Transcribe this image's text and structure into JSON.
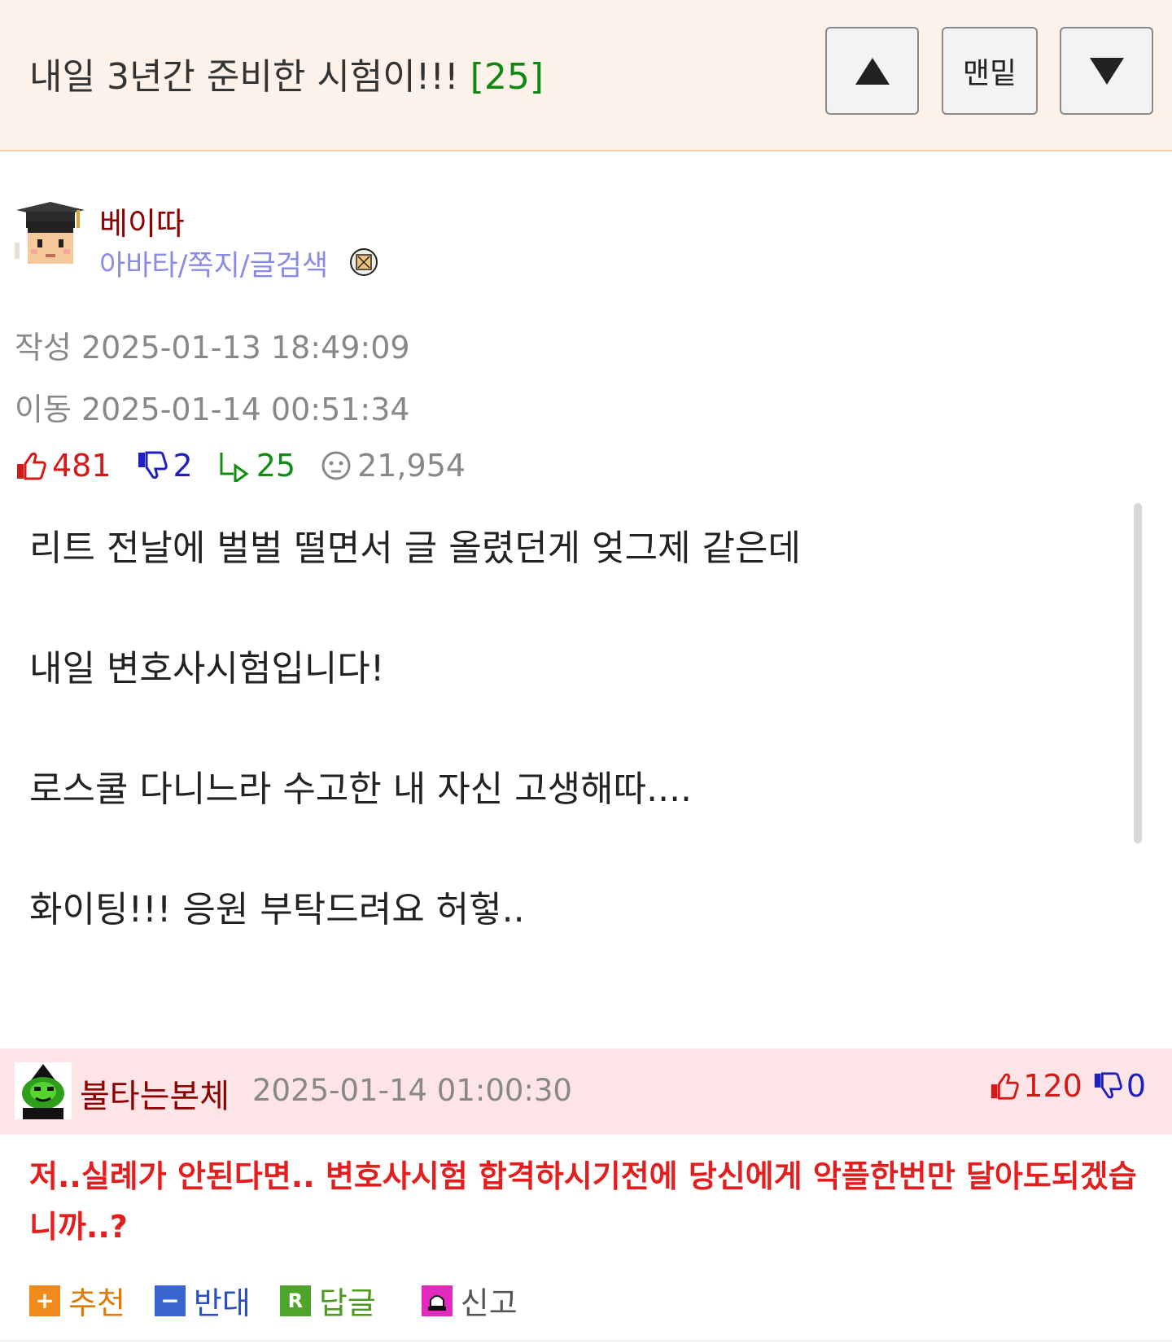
{
  "post": {
    "title": "내일 3년간 준비한 시험이!!!",
    "comment_count": "[25]"
  },
  "nav": {
    "bottom_label": "맨밑",
    "up_icon": "triangle-up-icon",
    "down_icon": "triangle-down-icon"
  },
  "author": {
    "name": "베이따",
    "links": "아바타/쪽지/글검색"
  },
  "meta": {
    "created": "작성 2025-01-13 18:49:09",
    "moved": "이동 2025-01-14 00:51:34"
  },
  "stats": {
    "upvotes": "481",
    "downvotes": "2",
    "replies": "25",
    "views": "21,954"
  },
  "content": {
    "lines": [
      "리트 전날에 벌벌 떨면서 글 올렸던게 엊그제 같은데",
      "내일 변호사시험입니다!",
      "로스쿨 다니느라 수고한 내 자신 고생해따....",
      "화이팅!!! 응원 부탁드려요 허헣.."
    ]
  },
  "comment": {
    "author": "불타는본체",
    "date": "2025-01-14 01:00:30",
    "upvotes": "120",
    "downvotes": "0",
    "text": "저..실례가 안된다면.. 변호사시험 합격하시기전에 당신에게 악플한번만 달아도되겠습니까..?"
  },
  "actions": {
    "recommend": "추천",
    "oppose": "반대",
    "reply": "답글",
    "report": "신고",
    "recommend_icon": "+",
    "oppose_icon": "−",
    "reply_icon": "R"
  },
  "colors": {
    "topbar_bg": "#fdf2e9",
    "comment_bg": "#fde4e6",
    "upvote": "#d41919",
    "downvote": "#2020c0",
    "reply": "#128c12",
    "comment_text": "#e31e1e"
  }
}
